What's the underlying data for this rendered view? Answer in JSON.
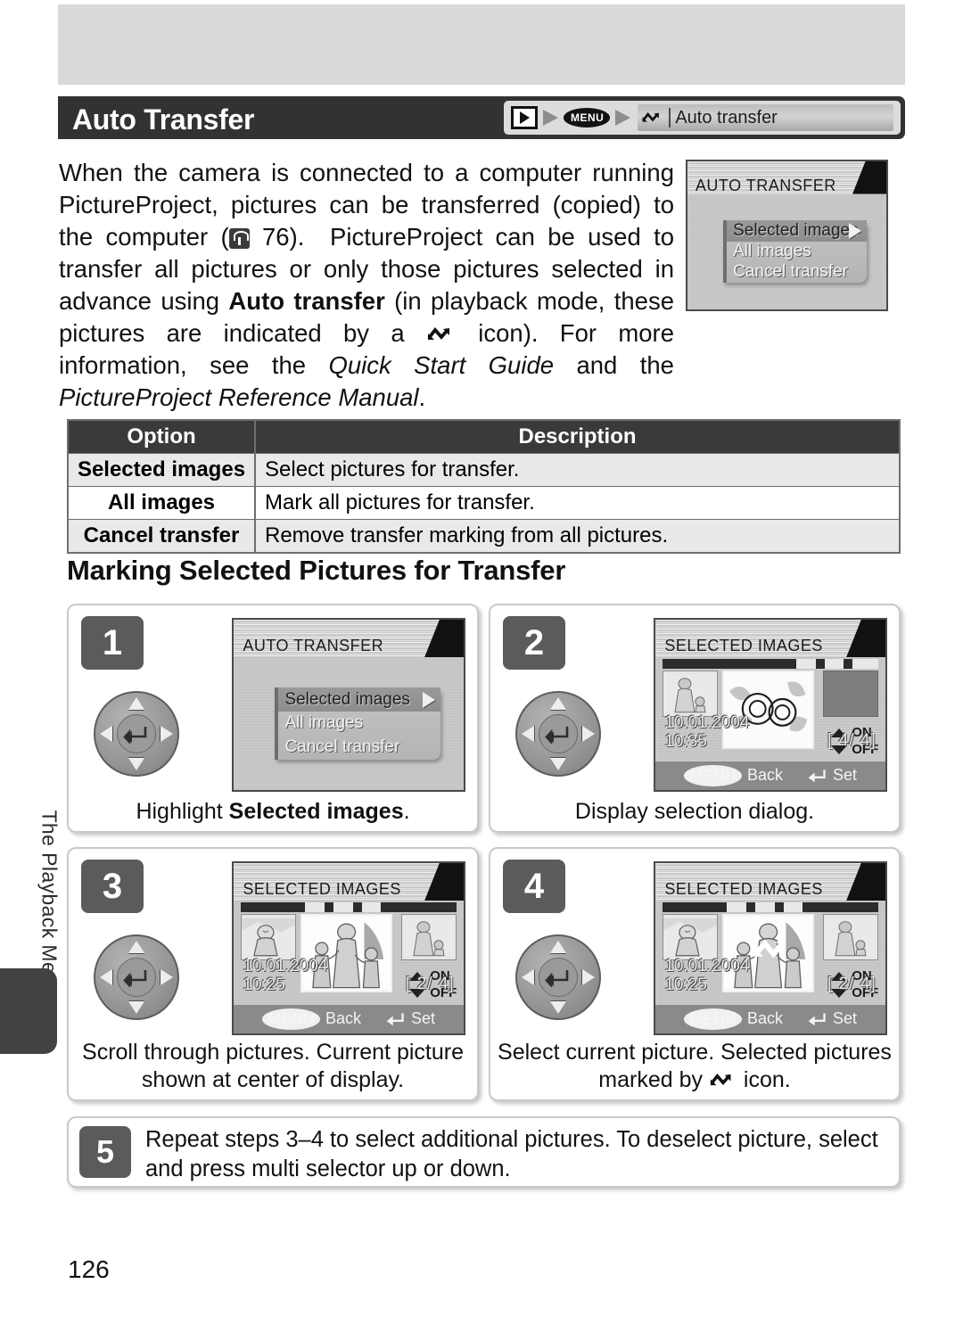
{
  "page": {
    "number": "126",
    "side_tab": "The Playback Menu"
  },
  "header": {
    "title": "Auto Transfer",
    "breadcrumb": {
      "playback_icon": "playback-icon",
      "menu_label": "MENU",
      "transfer_icon": "auto-transfer-icon",
      "item_label": "Auto transfer"
    }
  },
  "intro": {
    "p1": "When the camera is connected to a computer running PictureProject, pictures can be transferred (copied) to the computer (",
    "page_ref": "76).",
    "p2": "PictureProject can be used to transfer all pictures or only those pictures selected in advance using ",
    "bold1": "Auto transfer",
    "p3": " (in playback mode, these pictures are indicated by a ",
    "p4": " icon).  For more information, see the ",
    "italic1": "Quick Start Guide",
    "p5": " and the ",
    "italic2": "PictureProject Reference Manual",
    "p6": "."
  },
  "top_lcd": {
    "title": "AUTO TRANSFER",
    "items": [
      "Selected images",
      "All images",
      "Cancel transfer"
    ],
    "selected_index": 0
  },
  "table": {
    "headers": [
      "Option",
      "Description"
    ],
    "rows": [
      {
        "option": "Selected images",
        "description": "Select pictures for transfer."
      },
      {
        "option": "All images",
        "description": "Mark all pictures for transfer."
      },
      {
        "option": "Cancel transfer",
        "description": "Remove transfer marking from all pictures."
      }
    ]
  },
  "section": {
    "heading": "Marking Selected Pictures for Transfer"
  },
  "steps": [
    {
      "number": "1",
      "lcd": {
        "type": "menu",
        "title": "AUTO TRANSFER",
        "items": [
          "Selected images",
          "All images",
          "Cancel transfer"
        ],
        "selected_index": 0
      },
      "caption_pre": "Highlight ",
      "caption_bold": "Selected images",
      "caption_post": "."
    },
    {
      "number": "2",
      "lcd": {
        "type": "selection",
        "title": "SELECTED IMAGES",
        "date": "10.01.2004",
        "time": "10:35",
        "counter": "[    4/    4]",
        "on_label": "ON",
        "off_label": "OFF",
        "back_label": "Back",
        "set_label": "Set",
        "menu_badge": "MENU",
        "marked": false
      },
      "caption_pre": "Display selection dialog.",
      "caption_bold": "",
      "caption_post": ""
    },
    {
      "number": "3",
      "lcd": {
        "type": "selection",
        "title": "SELECTED IMAGES",
        "date": "10.01.2004",
        "time": "10:25",
        "counter": "[    2/    4]",
        "on_label": "ON",
        "off_label": "OFF",
        "back_label": "Back",
        "set_label": "Set",
        "menu_badge": "MENU",
        "marked": false
      },
      "caption_pre": "Scroll through pictures.  Current picture shown at center of display.",
      "caption_bold": "",
      "caption_post": ""
    },
    {
      "number": "4",
      "lcd": {
        "type": "selection",
        "title": "SELECTED IMAGES",
        "date": "10.01.2004",
        "time": "10:25",
        "counter": "[    2/    4]",
        "on_label": "ON",
        "off_label": "OFF",
        "back_label": "Back",
        "set_label": "Set",
        "menu_badge": "MENU",
        "marked": true
      },
      "caption_pre": "Select current picture.  Selected pictures marked by ",
      "caption_bold": "",
      "caption_post": " icon."
    }
  ],
  "step5": {
    "number": "5",
    "text": "Repeat steps 3–4 to select additional pictures.  To deselect picture, select and press multi selector up or down."
  },
  "colors": {
    "header_bar": "#333232",
    "banner": "#d9d9d9",
    "table_head": "#3a3a3a",
    "step_badge": "#5b5b5b"
  }
}
